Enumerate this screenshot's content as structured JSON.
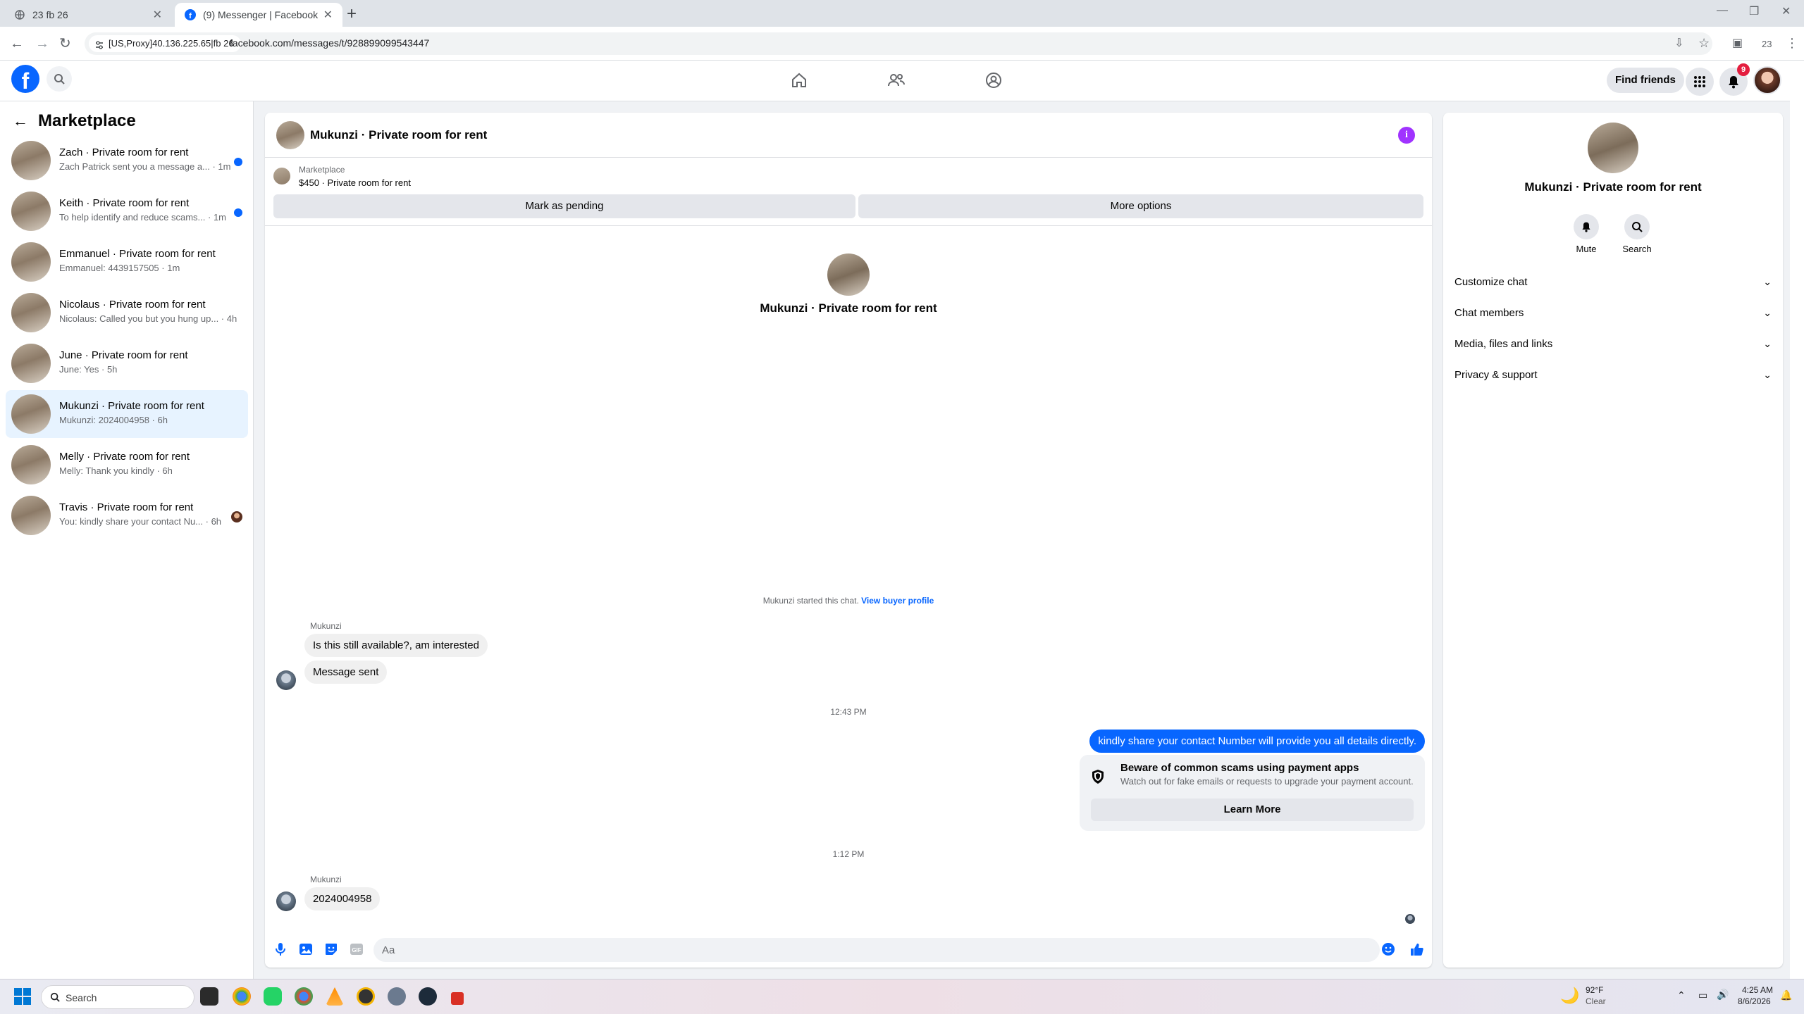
{
  "browser": {
    "tabs": [
      {
        "title": "23 fb 26"
      },
      {
        "title": "(9) Messenger | Facebook"
      }
    ],
    "proxy_chip": "[US,Proxy]40.136.225.65|fb 26",
    "url": "facebook.com/messages/t/928899099543447",
    "profile_count": "23"
  },
  "fb_header": {
    "find_friends": "Find friends",
    "notification_count": "9"
  },
  "sidebar": {
    "title": "Marketplace",
    "conversations": [
      {
        "name": "Zach · Private room for rent",
        "preview": "Zach Patrick sent you a message a... · 1m",
        "unread": true
      },
      {
        "name": "Keith · Private room for rent",
        "preview": "To help identify and reduce scams... · 1m",
        "unread": true
      },
      {
        "name": "Emmanuel · Private room for rent",
        "preview": "Emmanuel: 4439157505 · 1m",
        "unread": false
      },
      {
        "name": "Nicolaus · Private room for rent",
        "preview": "Nicolaus: Called you but you hung up... · 4h",
        "unread": false
      },
      {
        "name": "June · Private room for rent",
        "preview": "June: Yes · 5h",
        "unread": false
      },
      {
        "name": "Mukunzi · Private room for rent",
        "preview": "Mukunzi: 2024004958 · 6h",
        "unread": false,
        "active": true
      },
      {
        "name": "Melly · Private room for rent",
        "preview": "Melly: Thank you kindly · 6h",
        "unread": false
      },
      {
        "name": "Travis · Private room for rent",
        "preview": "You: kindly share your contact Nu... · 6h",
        "unread": false,
        "seen": true
      }
    ]
  },
  "chat": {
    "title": "Mukunzi · Private room for rent",
    "marketplace_label": "Marketplace",
    "listing": "$450 · Private room for rent",
    "mark_pending": "Mark as pending",
    "more_options": "More options",
    "intro_title": "Mukunzi · Private room for rent",
    "started_text": "Mukunzi started this chat.",
    "view_buyer": "View buyer profile",
    "messages": [
      {
        "sender": "Mukunzi",
        "text": "Is this still available?, am interested"
      },
      {
        "text": "Message sent"
      },
      {
        "timestamp": "12:43 PM"
      },
      {
        "outgoing": true,
        "text": "kindly share your contact Number will provide you all details directly."
      },
      {
        "timestamp": "1:12 PM"
      },
      {
        "sender": "Mukunzi",
        "text": "2024004958"
      }
    ],
    "scam_warning": {
      "title": "Beware of common scams using payment apps",
      "description": "Watch out for fake emails or requests to upgrade your payment account.",
      "button": "Learn More"
    },
    "composer_placeholder": "Aa"
  },
  "info_panel": {
    "title": "Mukunzi · Private room for rent",
    "mute": "Mute",
    "search": "Search",
    "sections": [
      "Customize chat",
      "Chat members",
      "Media, files and links",
      "Privacy & support"
    ]
  },
  "taskbar": {
    "search_placeholder": "Search",
    "weather_temp": "92°F",
    "weather_desc": "Clear",
    "time": "4:25 AM",
    "date": "8/6/2026"
  },
  "colors": {
    "fb_blue": "#0866ff",
    "active_row": "#e7f3ff",
    "info_purple": "#a033ff"
  }
}
